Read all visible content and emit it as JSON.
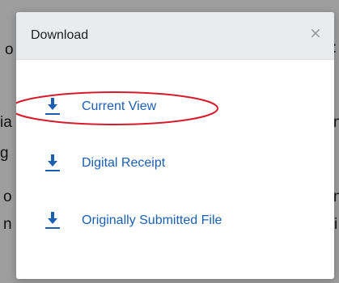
{
  "background_fragments": [
    {
      "id": "o",
      "text": "o"
    },
    {
      "id": "colon",
      "text": ":"
    },
    {
      "id": "ia",
      "text": "ia"
    },
    {
      "id": "n1",
      "text": "n"
    },
    {
      "id": "g",
      "text": "g"
    },
    {
      "id": "o2",
      "text": "o"
    },
    {
      "id": "n2",
      "text": "n"
    },
    {
      "id": "n3",
      "text": "n"
    },
    {
      "id": "i",
      "text": "i"
    }
  ],
  "modal": {
    "title": "Download",
    "close_symbol": "×",
    "options": [
      {
        "label": "Current View",
        "icon": "download-icon",
        "highlighted": true
      },
      {
        "label": "Digital Receipt",
        "icon": "download-icon",
        "highlighted": false
      },
      {
        "label": "Originally Submitted File",
        "icon": "download-icon",
        "highlighted": false
      }
    ]
  },
  "colors": {
    "accent": "#1a5fb4",
    "annotation": "#d81b2a",
    "header_bg": "#eaebed",
    "overlay": "#9e9e9e"
  }
}
